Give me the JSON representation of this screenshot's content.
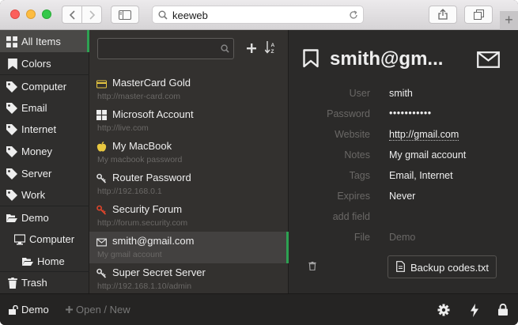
{
  "browser": {
    "url": "keeweb"
  },
  "menu": {
    "items": [
      {
        "label": "All Items",
        "icon": "grid-icon"
      },
      {
        "label": "Colors",
        "icon": "bookmark-icon"
      },
      {
        "label": "Computer",
        "icon": "tag-icon"
      },
      {
        "label": "Email",
        "icon": "tag-icon"
      },
      {
        "label": "Internet",
        "icon": "tag-icon"
      },
      {
        "label": "Money",
        "icon": "tag-icon"
      },
      {
        "label": "Server",
        "icon": "tag-icon"
      },
      {
        "label": "Work",
        "icon": "tag-icon"
      },
      {
        "label": "Demo",
        "icon": "folder-open-icon"
      },
      {
        "label": "Computer",
        "icon": "desktop-icon"
      },
      {
        "label": "Home",
        "icon": "folder-open-icon"
      },
      {
        "label": "Trash",
        "icon": "trash-icon"
      }
    ]
  },
  "list": {
    "search_placeholder": "",
    "entries": [
      {
        "title": "MasterCard Gold",
        "subtitle": "http://master-card.com",
        "icon": "credit-card-icon",
        "icon_color": "#e8c740"
      },
      {
        "title": "Microsoft Account",
        "subtitle": "http://live.com",
        "icon": "windows-icon",
        "icon_color": "#eeeeee"
      },
      {
        "title": "My MacBook",
        "subtitle": "My macbook password",
        "icon": "apple-icon",
        "icon_color": "#e8c740"
      },
      {
        "title": "Router Password",
        "subtitle": "http://192.168.0.1",
        "icon": "key-icon",
        "icon_color": "#dddddd"
      },
      {
        "title": "Security Forum",
        "subtitle": "http://forum.security.com",
        "icon": "key-icon",
        "icon_color": "#e0452b"
      },
      {
        "title": "smith@gmail.com",
        "subtitle": "My gmail account",
        "icon": "envelope-icon",
        "icon_color": "#dddddd"
      },
      {
        "title": "Super Secret Server",
        "subtitle": "http://192.168.1.10/admin",
        "icon": "key-icon",
        "icon_color": "#dddddd"
      }
    ]
  },
  "details": {
    "title": "smith@gm...",
    "fields": [
      {
        "label": "User",
        "value": "smith"
      },
      {
        "label": "Password",
        "value": "•••••••••••"
      },
      {
        "label": "Website",
        "value": "http://gmail.com"
      },
      {
        "label": "Notes",
        "value": "My gmail account"
      },
      {
        "label": "Tags",
        "value": "Email, Internet"
      },
      {
        "label": "Expires",
        "value": "Never"
      },
      {
        "label": "add field",
        "value": ""
      },
      {
        "label": "File",
        "value": "Demo"
      }
    ],
    "attachment": "Backup codes.txt"
  },
  "footer": {
    "file_name": "Demo",
    "open_new": "Open / New"
  },
  "colors": {
    "accent": "#2da152"
  }
}
